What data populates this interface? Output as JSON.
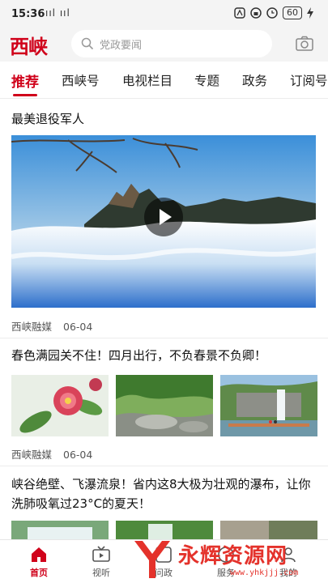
{
  "status_bar": {
    "time": "15:36",
    "signal_icons": "ııl ııl",
    "battery": "60"
  },
  "header": {
    "logo": "西峡",
    "search_placeholder": "党政要闻"
  },
  "tabs": [
    {
      "label": "推荐",
      "active": true
    },
    {
      "label": "西峡号"
    },
    {
      "label": "电视栏目"
    },
    {
      "label": "专题"
    },
    {
      "label": "政务"
    },
    {
      "label": "订阅号"
    }
  ],
  "feed": [
    {
      "title": "最美退役军人",
      "source": "西峡融媒",
      "date": "06-04",
      "type": "video"
    },
    {
      "title": "春色满园关不住！四月出行，不负春景不负卿！",
      "source": "西峡融媒",
      "date": "06-04",
      "type": "three-images"
    },
    {
      "title": "峡谷绝壁、飞瀑流泉！省内这8大极为壮观的瀑布，让你洗肺吸氧过23°C的夏天！",
      "type": "three-images"
    }
  ],
  "bottom_nav": [
    {
      "label": "首页",
      "icon": "home-icon",
      "active": true
    },
    {
      "label": "视听",
      "icon": "tv-icon"
    },
    {
      "label": "问政",
      "icon": "question-icon"
    },
    {
      "label": "服务",
      "icon": "service-icon"
    },
    {
      "label": "我的",
      "icon": "user-icon"
    }
  ],
  "watermark": {
    "text": "永辉资源网",
    "url": "www.yhkjjj.com"
  },
  "colors": {
    "accent": "#d0021b",
    "header_bg": "#f4f4f4"
  }
}
